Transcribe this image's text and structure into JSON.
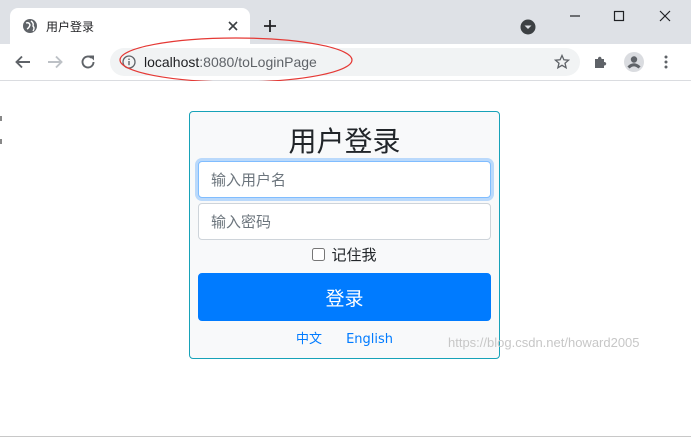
{
  "browser": {
    "tab": {
      "title": "用户登录",
      "close_icon": "close-icon",
      "favicon": "globe-icon"
    },
    "new_tab_icon": "plus-icon",
    "address_bar": {
      "host": "localhost",
      "rest": ":8080/toLoginPage",
      "icon": "info-icon"
    },
    "colors": {
      "annotation": "#e53935",
      "accent": "#1a73e8"
    }
  },
  "page": {
    "title": "用户登录",
    "username_placeholder": "输入用户名",
    "password_placeholder": "输入密码",
    "remember_label": "记住我",
    "remember_checked": false,
    "login_button": "登录",
    "lang_zh": "中文",
    "lang_en": "English",
    "colors": {
      "card_border": "#17a2b8",
      "primary": "#007bff"
    }
  },
  "watermark": "https://blog.csdn.net/howard2005"
}
